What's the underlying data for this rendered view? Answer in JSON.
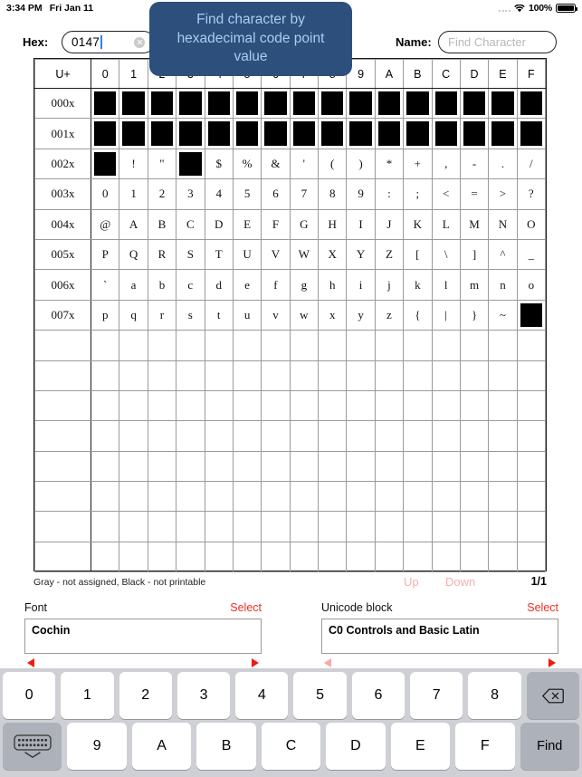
{
  "status_bar": {
    "time": "3:34 PM",
    "date": "Fri Jan 11",
    "battery_percent": "100%",
    "wifi_icon": "wifi-icon",
    "battery_icon": "battery-icon",
    "signal_icon": "signal-dots-icon"
  },
  "tooltip": {
    "text": "Find character by hexadecimal code point value",
    "background": "#2d4f7c",
    "text_color": "#a9cdf0"
  },
  "search": {
    "hex_label": "Hex:",
    "hex_value": "0147",
    "hex_clear_icon": "clear-icon",
    "name_label": "Name:",
    "name_value": "",
    "name_placeholder": "Find Character"
  },
  "table": {
    "corner_label": "U+",
    "columns": [
      "0",
      "1",
      "2",
      "3",
      "4",
      "5",
      "6",
      "7",
      "8",
      "9",
      "A",
      "B",
      "C",
      "D",
      "E",
      "F"
    ],
    "rows": [
      {
        "label": "000x",
        "cells": [
          "#",
          "#",
          "#",
          "#",
          "#",
          "#",
          "#",
          "#",
          "#",
          "#",
          "#",
          "#",
          "#",
          "#",
          "#",
          "#"
        ]
      },
      {
        "label": "001x",
        "cells": [
          "#",
          "#",
          "#",
          "#",
          "#",
          "#",
          "#",
          "#",
          "#",
          "#",
          "#",
          "#",
          "#",
          "#",
          "#",
          "#"
        ]
      },
      {
        "label": "002x",
        "cells": [
          "#",
          "!",
          "\"",
          "#",
          "$",
          "%",
          "&",
          "'",
          "(",
          ")",
          "*",
          "+",
          ",",
          "-",
          ".",
          "/"
        ]
      },
      {
        "label": "003x",
        "cells": [
          "0",
          "1",
          "2",
          "3",
          "4",
          "5",
          "6",
          "7",
          "8",
          "9",
          ":",
          ";",
          "<",
          "=",
          ">",
          "?"
        ]
      },
      {
        "label": "004x",
        "cells": [
          "@",
          "A",
          "B",
          "C",
          "D",
          "E",
          "F",
          "G",
          "H",
          "I",
          "J",
          "K",
          "L",
          "M",
          "N",
          "O"
        ]
      },
      {
        "label": "005x",
        "cells": [
          "P",
          "Q",
          "R",
          "S",
          "T",
          "U",
          "V",
          "W",
          "X",
          "Y",
          "Z",
          "[",
          "\\",
          "]",
          "^",
          "_"
        ]
      },
      {
        "label": "006x",
        "cells": [
          "`",
          "a",
          "b",
          "c",
          "d",
          "e",
          "f",
          "g",
          "h",
          "i",
          "j",
          "k",
          "l",
          "m",
          "n",
          "o"
        ]
      },
      {
        "label": "007x",
        "cells": [
          "p",
          "q",
          "r",
          "s",
          "t",
          "u",
          "v",
          "w",
          "x",
          "y",
          "z",
          "{",
          "|",
          "}",
          "~",
          "#"
        ]
      },
      {
        "label": "",
        "cells": [
          "",
          "",
          "",
          "",
          "",
          "",
          "",
          "",
          "",
          "",
          "",
          "",
          "",
          "",
          "",
          ""
        ]
      },
      {
        "label": "",
        "cells": [
          "",
          "",
          "",
          "",
          "",
          "",
          "",
          "",
          "",
          "",
          "",
          "",
          "",
          "",
          "",
          ""
        ]
      },
      {
        "label": "",
        "cells": [
          "",
          "",
          "",
          "",
          "",
          "",
          "",
          "",
          "",
          "",
          "",
          "",
          "",
          "",
          "",
          ""
        ]
      },
      {
        "label": "",
        "cells": [
          "",
          "",
          "",
          "",
          "",
          "",
          "",
          "",
          "",
          "",
          "",
          "",
          "",
          "",
          "",
          ""
        ]
      },
      {
        "label": "",
        "cells": [
          "",
          "",
          "",
          "",
          "",
          "",
          "",
          "",
          "",
          "",
          "",
          "",
          "",
          "",
          "",
          ""
        ]
      },
      {
        "label": "",
        "cells": [
          "",
          "",
          "",
          "",
          "",
          "",
          "",
          "",
          "",
          "",
          "",
          "",
          "",
          "",
          "",
          ""
        ]
      },
      {
        "label": "",
        "cells": [
          "",
          "",
          "",
          "",
          "",
          "",
          "",
          "",
          "",
          "",
          "",
          "",
          "",
          "",
          "",
          ""
        ]
      },
      {
        "label": "",
        "cells": [
          "",
          "",
          "",
          "",
          "",
          "",
          "",
          "",
          "",
          "",
          "",
          "",
          "",
          "",
          "",
          ""
        ]
      }
    ],
    "black_marker": "#"
  },
  "legend": {
    "text": "Gray - not assigned, Black - not printable",
    "up_label": "Up",
    "down_label": "Down",
    "page_indicator": "1/1",
    "nav_disabled_color": "#f6b0ae"
  },
  "font_panel": {
    "title": "Font",
    "select_label": "Select",
    "value": "Cochin",
    "prev_icon": "triangle-left-icon",
    "next_icon": "triangle-right-icon"
  },
  "block_panel": {
    "title": "Unicode block",
    "select_label": "Select",
    "value": "C0 Controls and Basic Latin",
    "prev_icon": "triangle-left-icon",
    "next_icon": "triangle-right-icon"
  },
  "keyboard": {
    "row1": [
      "0",
      "1",
      "2",
      "3",
      "4",
      "5",
      "6",
      "7",
      "8"
    ],
    "backspace_icon": "backspace-icon",
    "dismiss_icon": "keyboard-dismiss-icon",
    "row2": [
      "9",
      "A",
      "B",
      "C",
      "D",
      "E",
      "F"
    ],
    "find_label": "Find",
    "key_bg": "#ffffff",
    "dark_key_bg": "#adb1b9",
    "background": "#ced0d6"
  },
  "accent_colors": {
    "red_link": "#f22d24",
    "red_arrow": "#ee1c10",
    "caret_blue": "#2a7fff"
  }
}
